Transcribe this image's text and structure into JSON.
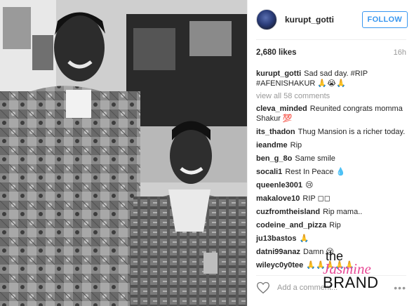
{
  "post": {
    "photo_alt": "",
    "header": {
      "username": "kurupt_gotti",
      "follow_label": "FOLLOW"
    },
    "likes": "2,680 likes",
    "time": "16h",
    "caption": {
      "user": "kurupt_gotti",
      "text": "Sad sad day. #RIP #AFENISHAKUR 🙏😭🙏"
    },
    "view_all": "view all 58 comments",
    "comments": [
      {
        "user": "cleva_minded",
        "text": "Reunited congrats momma Shakur 💯"
      },
      {
        "user": "its_thadon",
        "text": "Thug Mansion is a richer today."
      },
      {
        "user": "ieandme",
        "text": "Rip"
      },
      {
        "user": "ben_g_8o",
        "text": "Same smile"
      },
      {
        "user": "socali1",
        "text": "Rest In Peace 💧"
      },
      {
        "user": "queenle3001",
        "text": "😢"
      },
      {
        "user": "makalove10",
        "text": "RIP ◻◻"
      },
      {
        "user": "cuzfromtheisland",
        "text": "Rip mama.."
      },
      {
        "user": "codeine_and_pizza",
        "text": "Rip"
      },
      {
        "user": "ju13bastos",
        "text": "🙏"
      },
      {
        "user": "datni99anaz",
        "text": "Damn 😔"
      },
      {
        "user": "wileyc0y0tee",
        "text": "🙏🙏🙏🙏🙏"
      }
    ],
    "add_comment_placeholder": "Add a comment...",
    "more_label": "•••"
  },
  "watermark": {
    "line1": "the",
    "line2": "Jasmine",
    "line3": "BRAND"
  }
}
